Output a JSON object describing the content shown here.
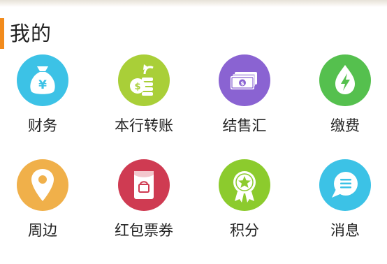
{
  "section": {
    "title": "我的",
    "accent_color": "#f28b1c"
  },
  "rows": [
    [
      {
        "label": "财务",
        "icon": "money-bag-icon",
        "color": "#3cc2e6"
      },
      {
        "label": "本行转账",
        "icon": "coin-transfer-icon",
        "color": "#a9cf38"
      },
      {
        "label": "结售汇",
        "icon": "banknotes-icon",
        "color": "#8a63d2"
      },
      {
        "label": "缴费",
        "icon": "lightning-drop-icon",
        "color": "#55c04e"
      }
    ],
    [
      {
        "label": "周边",
        "icon": "location-pin-icon",
        "color": "#f0b04a"
      },
      {
        "label": "红包票券",
        "icon": "red-envelope-icon",
        "color": "#cf3b52"
      },
      {
        "label": "积分",
        "icon": "star-medal-icon",
        "color": "#8ccb2d"
      },
      {
        "label": "消息",
        "icon": "message-bubble-icon",
        "color": "#3cc2e6"
      }
    ]
  ]
}
